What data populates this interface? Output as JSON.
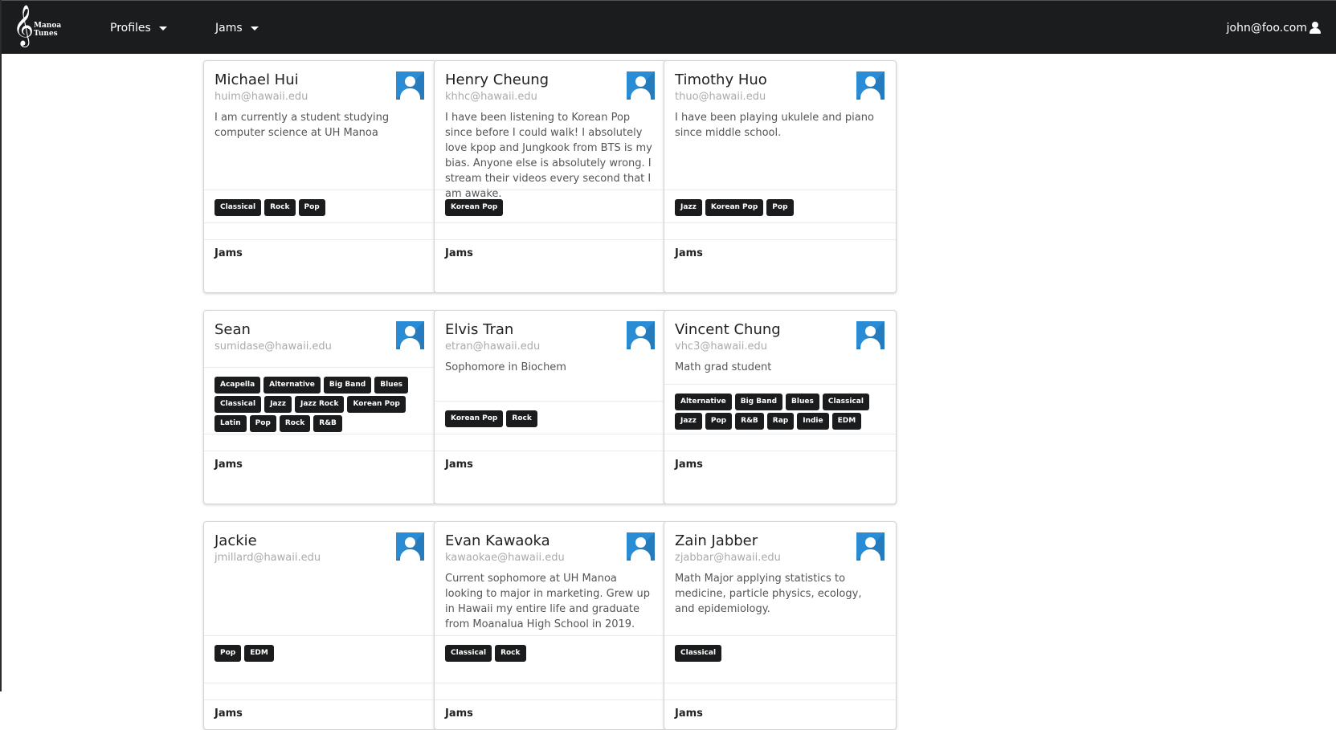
{
  "navbar": {
    "logo_text": "Manoa Tunes",
    "menu": [
      {
        "label": "Profiles"
      },
      {
        "label": "Jams"
      }
    ],
    "user": "john@foo.com"
  },
  "profiles": [
    {
      "name": "Michael Hui",
      "email": "huim@hawaii.edu",
      "bio": "I am currently a student studying computer science at UH Manoa",
      "tags": [
        "Classical",
        "Rock",
        "Pop"
      ],
      "jams_label": "Jams"
    },
    {
      "name": "Henry Cheung",
      "email": "khhc@hawaii.edu",
      "bio": "I have been listening to Korean Pop since before I could walk! I absolutely love kpop and Jungkook from BTS is my bias. Anyone else is absolutely wrong. I stream their videos every second that I am awake.",
      "tags": [
        "Korean Pop"
      ],
      "jams_label": "Jams"
    },
    {
      "name": "Timothy Huo",
      "email": "thuo@hawaii.edu",
      "bio": "I have been playing ukulele and piano since middle school.",
      "tags": [
        "Jazz",
        "Korean Pop",
        "Pop"
      ],
      "jams_label": "Jams"
    },
    {
      "name": "Sean",
      "email": "sumidase@hawaii.edu",
      "bio": "",
      "tags": [
        "Acapella",
        "Alternative",
        "Big Band",
        "Blues",
        "Classical",
        "Jazz",
        "Jazz Rock",
        "Korean Pop",
        "Latin",
        "Pop",
        "Rock",
        "R&B"
      ],
      "jams_label": "Jams"
    },
    {
      "name": "Elvis Tran",
      "email": "etran@hawaii.edu",
      "bio": "Sophomore in Biochem",
      "tags": [
        "Korean Pop",
        "Rock"
      ],
      "jams_label": "Jams"
    },
    {
      "name": "Vincent Chung",
      "email": "vhc3@hawaii.edu",
      "bio": "Math grad student",
      "tags": [
        "Alternative",
        "Big Band",
        "Blues",
        "Classical",
        "Jazz",
        "Pop",
        "R&B",
        "Rap",
        "Indie",
        "EDM"
      ],
      "jams_label": "Jams"
    },
    {
      "name": "Jackie",
      "email": "jmillard@hawaii.edu",
      "bio": "",
      "tags": [
        "Pop",
        "EDM"
      ],
      "jams_label": "Jams"
    },
    {
      "name": "Evan Kawaoka",
      "email": "kawaokae@hawaii.edu",
      "bio": "Current sophomore at UH Manoa looking to major in marketing. Grew up in Hawaii my entire life and graduate from Moanalua High School in 2019.",
      "tags": [
        "Classical",
        "Rock"
      ],
      "jams_label": "Jams"
    },
    {
      "name": "Zain Jabber",
      "email": "zjabbar@hawaii.edu",
      "bio": "Math Major applying statistics to medicine, particle physics, ecology, and epidemiology.",
      "tags": [
        "Classical"
      ],
      "jams_label": "Jams"
    }
  ]
}
